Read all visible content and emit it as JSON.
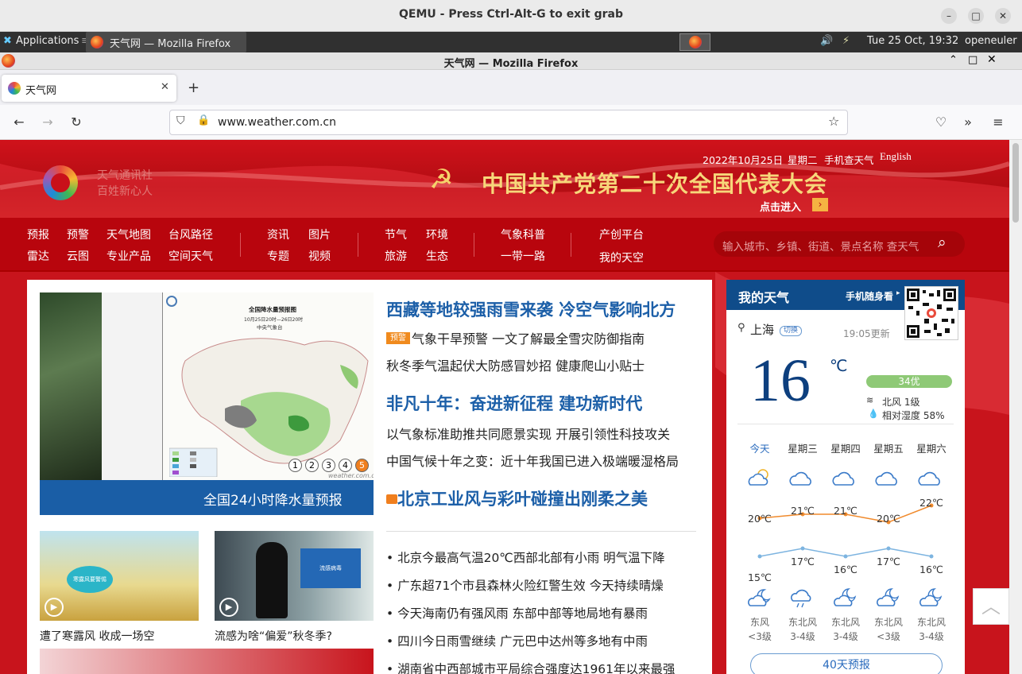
{
  "qemu": {
    "title": "QEMU - Press Ctrl-Alt-G to exit grab"
  },
  "panel": {
    "apps": "Applications",
    "task": "天气网 — Mozilla Firefox",
    "datetime": "Tue 25 Oct, 19:32",
    "user": "openeuler"
  },
  "firefox": {
    "window_title": "天气网 — Mozilla Firefox",
    "tab_title": "天气网",
    "url": "www.weather.com.cn"
  },
  "header": {
    "tagline1": "天气通讯社",
    "tagline2": "百姓新心人",
    "date": "2022年10月25日",
    "weekday": "星期二",
    "mobile": "手机查天气",
    "english": "English",
    "banner": "中国共产党第二十次全国代表大会",
    "enter": "点击进入"
  },
  "menu": [
    [
      "预报",
      "雷达"
    ],
    [
      "预警",
      "云图"
    ],
    [
      "天气地图",
      "专业产品"
    ],
    [
      "台风路径",
      "空间天气"
    ],
    [
      "资讯",
      "专题"
    ],
    [
      "图片",
      "视频"
    ],
    [
      "节气",
      "旅游"
    ],
    [
      "环境",
      "生态"
    ],
    [
      "气象科普",
      "一带一路"
    ],
    [
      "产创平台",
      "我的天空"
    ]
  ],
  "search": {
    "placeholder": "输入城市、乡镇、街道、景点名称 查天气"
  },
  "slider": {
    "caption": "全国24小时降水量预报",
    "map_title": "全国降水量预报图",
    "map_sub": "10月25日20时—26日20时",
    "map_org": "中央气象台",
    "pages": [
      "1",
      "2",
      "3",
      "4",
      "5"
    ],
    "watermark": "weather.com.cn"
  },
  "headlines": {
    "h1": "西藏等地较强雨雪来袭 冷空气影响北方",
    "h1_tag": "预警",
    "l1": "气象干旱预警 一文了解最全雪灾防御指南",
    "l2": "秋冬季气温起伏大防感冒妙招 健康爬山小贴士",
    "h2": "非凡十年：奋进新征程 建功新时代",
    "l3": "以气象标准助推共同愿景实现 开展引领性科技攻关",
    "l4": "中国气候十年之变：近十年我国已进入极端暖湿格局",
    "h3": "北京工业风与彩叶碰撞出刚柔之美",
    "b1": "北京今最高气温20℃西部北部有小雨 明气温下降",
    "b2": "广东超71个市县森林火险红警生效 今天持续晴燥",
    "b3": "今天海南仍有强风雨 东部中部等地局地有暴雨",
    "b4": "四川今日雨雪继续 广元巴中达州等多地有中雨",
    "b5": "湖南省中西部城市平局综合强度达1961年以来最强"
  },
  "videos": [
    {
      "caption": "遭了寒露风 收成一场空",
      "thumb_text": "寒露风要警惕"
    },
    {
      "caption": "流感为啥“偏爱”秋冬季?",
      "thumb_text": "流感病毒"
    }
  ],
  "myweather": {
    "title": "我的天气",
    "mobile": "手机随身看",
    "city": "上海",
    "switch": "切换",
    "updated": "19:05更新",
    "temp": "16",
    "unit": "℃",
    "aqi": "34优",
    "wind": "北风 1级",
    "humidity": "相对湿度 58%",
    "days": [
      "今天",
      "星期三",
      "星期四",
      "星期五",
      "星期六"
    ],
    "highs": [
      "20℃",
      "21℃",
      "21℃",
      "20℃",
      "22℃"
    ],
    "lows": [
      "15℃",
      "17℃",
      "16℃",
      "17℃",
      "16℃"
    ],
    "winds": [
      [
        "东风",
        "<3级"
      ],
      [
        "东北风",
        "3-4级"
      ],
      [
        "东北风",
        "3-4级"
      ],
      [
        "东北风",
        "<3级"
      ],
      [
        "东北风",
        "3-4级"
      ]
    ],
    "forecast40": "40天预报"
  }
}
